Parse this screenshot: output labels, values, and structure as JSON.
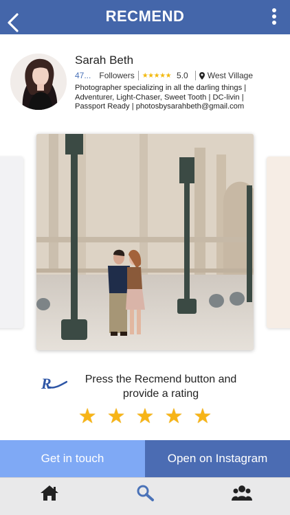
{
  "header": {
    "title": "RECMEND",
    "back_icon": "chevron-left-icon",
    "menu_icon": "vertical-ellipsis-icon"
  },
  "profile": {
    "name": "Sarah Beth",
    "followers_count": "47...",
    "followers_label": "Followers",
    "stars_display": "★★★★★",
    "rating": "5.0",
    "location_icon": "map-pin-icon",
    "location": "West Village",
    "bio_lines": [
      "Photographer specializing in all the darling things |",
      "Adventurer, Light-Chaser, Sweet Tooth | DC-livin |",
      "Passport Ready |  photosbysarahbeth@gmail.com"
    ]
  },
  "prompt": {
    "logo": "recmend-r-logo",
    "line1": "Press the Recmend button and",
    "line2": "provide a rating",
    "star_glyph": "★",
    "stars": 5
  },
  "actions": {
    "get_in_touch": "Get in touch",
    "open_instagram": "Open on Instagram"
  },
  "tabbar": {
    "items": [
      "home-icon",
      "search-icon",
      "people-icon"
    ],
    "active": "search-icon"
  },
  "colors": {
    "header": "#4466aa",
    "accent_blue": "#4a72b8",
    "get_in_touch_bg": "#7fa9f5",
    "instagram_bg": "#4b6cb3",
    "star": "#f7b416",
    "tab_icon": "#222222",
    "tab_active": "#4a72b8"
  }
}
